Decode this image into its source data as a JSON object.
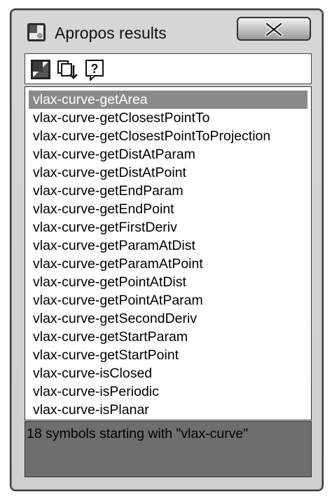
{
  "window": {
    "title": "Apropos results"
  },
  "toolbar": {
    "buttons": [
      {
        "icon": "edit-icon"
      },
      {
        "icon": "copy-down-icon"
      },
      {
        "icon": "help-icon"
      }
    ]
  },
  "results": {
    "items": [
      "vlax-curve-getArea",
      "vlax-curve-getClosestPointTo",
      "vlax-curve-getClosestPointToProjection",
      "vlax-curve-getDistAtParam",
      "vlax-curve-getDistAtPoint",
      "vlax-curve-getEndParam",
      "vlax-curve-getEndPoint",
      "vlax-curve-getFirstDeriv",
      "vlax-curve-getParamAtDist",
      "vlax-curve-getParamAtPoint",
      "vlax-curve-getPointAtDist",
      "vlax-curve-getPointAtParam",
      "vlax-curve-getSecondDeriv",
      "vlax-curve-getStartParam",
      "vlax-curve-getStartPoint",
      "vlax-curve-isClosed",
      "vlax-curve-isPeriodic",
      "vlax-curve-isPlanar"
    ],
    "selected_index": 0
  },
  "status": {
    "text": "18 symbols starting with \"vlax-curve\""
  }
}
